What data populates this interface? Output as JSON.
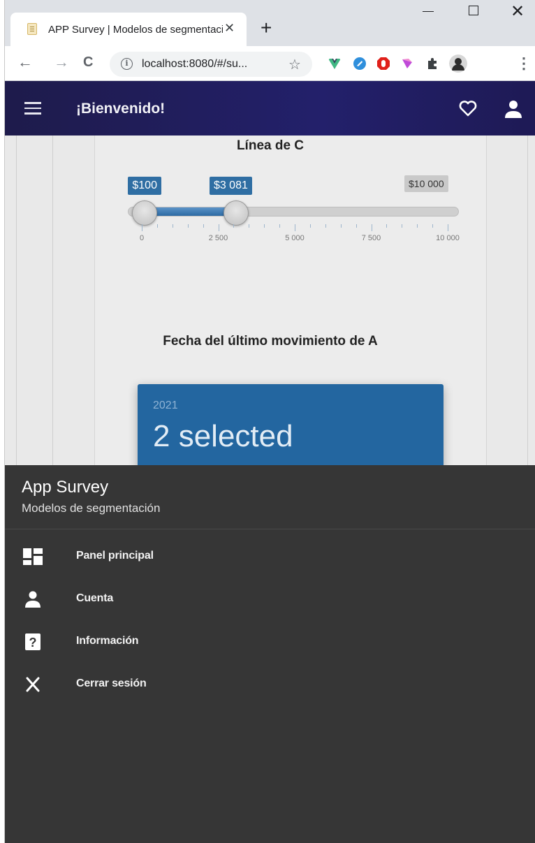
{
  "browser": {
    "tab_title": "APP Survey | Modelos de segmentación",
    "tab_close": "✕",
    "new_tab": "+",
    "url": "localhost:8080/#/su...",
    "back": "←",
    "forward": "→",
    "reload": "C",
    "kebab": "⋮"
  },
  "appbar": {
    "title": "¡Bienvenido!"
  },
  "slider": {
    "title": "Línea de C",
    "value_low_label": "$100",
    "value_high_label": "$3 081",
    "max_label": "$10 000",
    "min": 0,
    "max": 10000,
    "low": 100,
    "high": 3081,
    "tick_labels": [
      "0",
      "2 500",
      "5 000",
      "7 500",
      "10 000"
    ]
  },
  "date": {
    "title": "Fecha del último movimiento de A",
    "year": "2021",
    "value": "2 selected"
  },
  "drawer": {
    "title": "App Survey",
    "subtitle": "Modelos de segmentación",
    "items": [
      {
        "label": "Panel principal",
        "icon": "dashboard-icon"
      },
      {
        "label": "Cuenta",
        "icon": "account-icon"
      },
      {
        "label": "Información",
        "icon": "help-icon"
      },
      {
        "label": "Cerrar sesión",
        "icon": "close-icon"
      }
    ]
  },
  "colors": {
    "appbar": "#1e1b4b",
    "drawer": "#363636",
    "accent": "#2366a0"
  }
}
